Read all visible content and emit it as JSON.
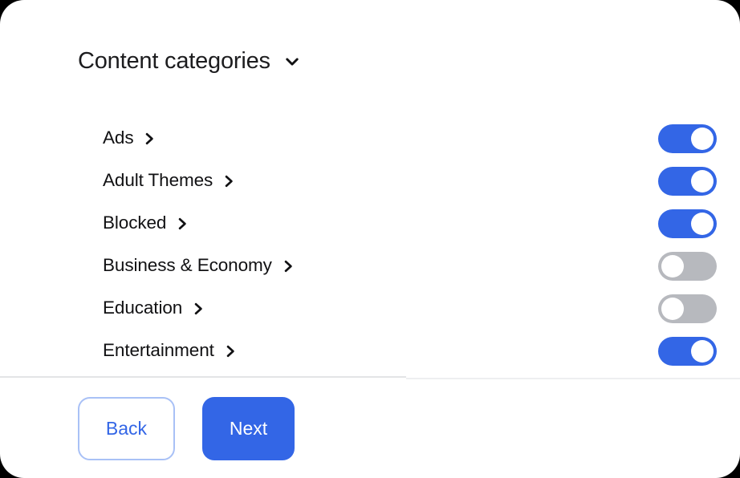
{
  "card": {
    "background": "#ffffff",
    "corner_radius_px": 30
  },
  "header": {
    "title": "Content categories",
    "expand_icon": "chevron-down-icon",
    "expanded": true
  },
  "colors": {
    "accent_blue": "#3366e6",
    "toggle_off_gray": "#b7b9be",
    "toggle_knob": "#ffffff",
    "text_primary": "#111113",
    "divider": "#e3e4e6",
    "back_border": "#a9c1f6"
  },
  "categories": {
    "row_icon": "chevron-right-icon",
    "items": [
      {
        "label": "Ads",
        "enabled": true,
        "state_label": "on"
      },
      {
        "label": "Adult Themes",
        "enabled": true,
        "state_label": "on"
      },
      {
        "label": "Blocked",
        "enabled": true,
        "state_label": "on"
      },
      {
        "label": "Business & Economy",
        "enabled": false,
        "state_label": "off"
      },
      {
        "label": "Education",
        "enabled": false,
        "state_label": "off"
      },
      {
        "label": "Entertainment",
        "enabled": true,
        "state_label": "on"
      }
    ]
  },
  "footer": {
    "back_label": "Back",
    "next_label": "Next"
  }
}
